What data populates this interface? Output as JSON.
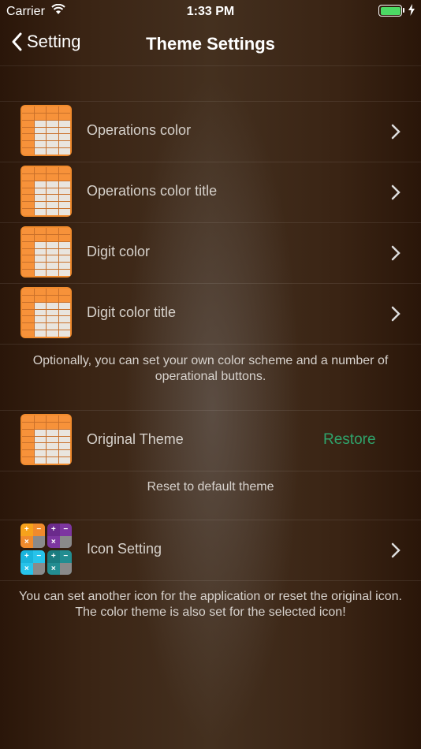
{
  "status": {
    "carrier": "Carrier",
    "time": "1:33 PM"
  },
  "nav": {
    "back_label": "Setting",
    "title": "Theme Settings"
  },
  "colors_section": {
    "items": [
      {
        "label": "Operations color"
      },
      {
        "label": "Operations color title"
      },
      {
        "label": "Digit color"
      },
      {
        "label": "Digit color title"
      }
    ],
    "footer": "Optionally, you can set your own color scheme and a number of operational buttons."
  },
  "theme_section": {
    "label": "Original Theme",
    "action": "Restore",
    "footer": "Reset to default theme"
  },
  "icon_section": {
    "label": "Icon Setting",
    "footer_line1": "You can set another icon for the application or reset the original icon.",
    "footer_line2": "The color theme is also set for the selected icon!"
  },
  "icon_symbols": {
    "plus": "+",
    "minus": "−",
    "times": "×"
  },
  "colors": {
    "accent": "#2fa36b",
    "battery": "#4cd964",
    "calc_orange": "#f08a2c"
  }
}
